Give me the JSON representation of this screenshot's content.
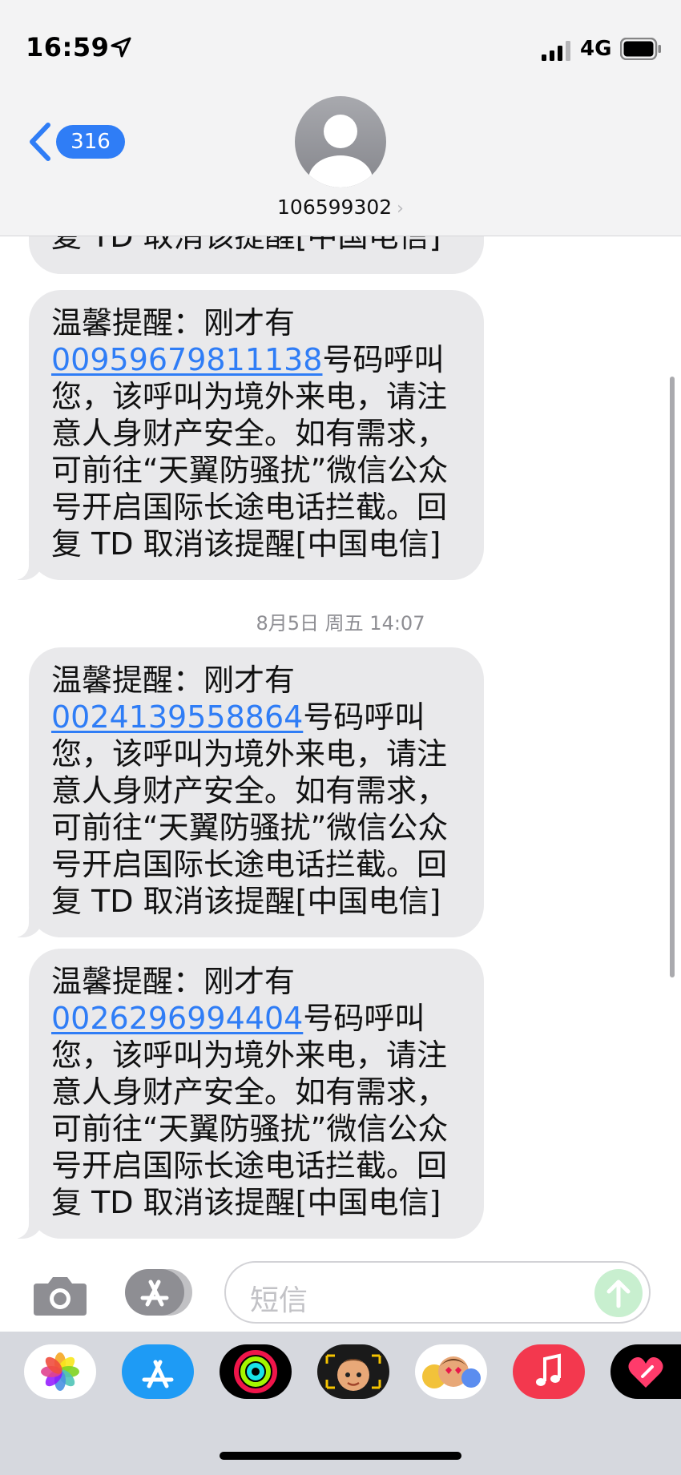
{
  "status_bar": {
    "time": "16:59",
    "network": "4G"
  },
  "header": {
    "back_count": "316",
    "contact_name": "106599302"
  },
  "messages": [
    {
      "partial_text": "复 TD 取消该提醒[中国电信]"
    },
    {
      "prefix": "温馨提醒：刚才有",
      "number": "00959679811138",
      "after_number": "号码呼叫",
      "body": "您，该呼叫为境外来电，请注意人身财产安全。如有需求，可前往“天翼防骚扰”微信公众号开启国际长途电话拦截。回复 TD 取消该提醒[中国电信]"
    },
    {
      "prefix": "温馨提醒：刚才有",
      "number": "0024139558864",
      "after_number": "号码呼叫",
      "body": "您，该呼叫为境外来电，请注意人身财产安全。如有需求，可前往“天翼防骚扰”微信公众号开启国际长途电话拦截。回复 TD 取消该提醒[中国电信]"
    },
    {
      "prefix": "温馨提醒：刚才有",
      "number": "0026296994404",
      "after_number": "号码呼叫",
      "body": "您，该呼叫为境外来电，请注意人身财产安全。如有需求，可前往“天翼防骚扰”微信公众号开启国际长途电话拦截。回复 TD 取消该提醒[中国电信]"
    }
  ],
  "timestamp": "8月5日 周五 14:07",
  "composer": {
    "placeholder": "短信"
  },
  "app_tray": [
    "photos-icon",
    "app-store-icon",
    "activity-icon",
    "memoji-icon",
    "memoji-stickers-icon",
    "music-icon",
    "heart-digital-touch-icon"
  ],
  "colors": {
    "link": "#2f7df6",
    "bubble": "#e9e9eb",
    "header_bg": "#f3f3f4",
    "tray_bg": "#d6d8de"
  }
}
